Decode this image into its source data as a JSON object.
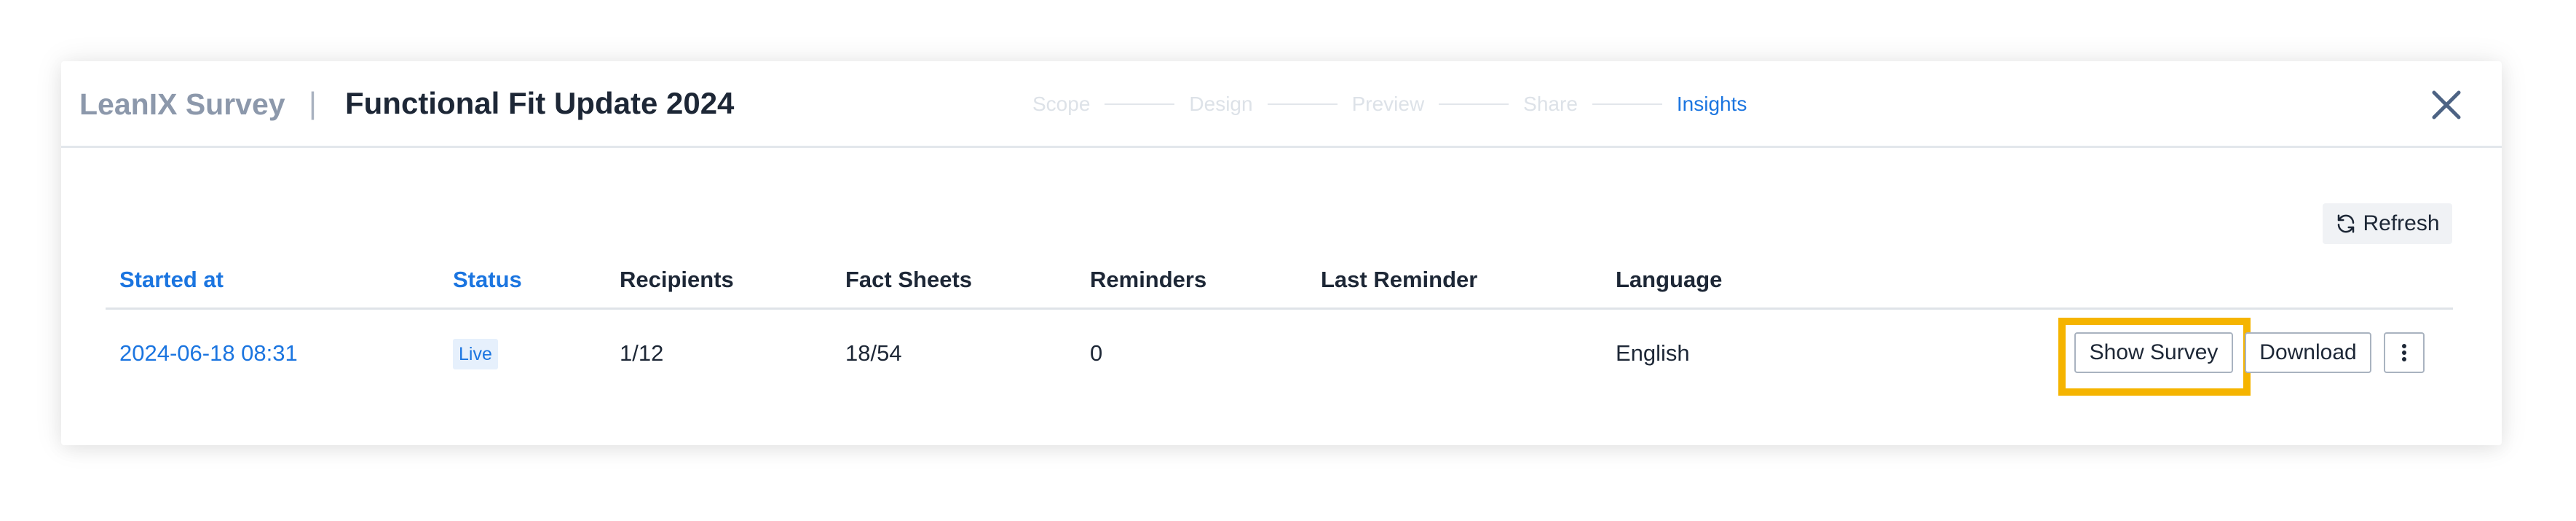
{
  "header": {
    "brand": "LeanIX Survey",
    "divider": "|",
    "title": "Functional Fit Update 2024",
    "steps": [
      {
        "label": "Scope",
        "active": false
      },
      {
        "label": "Design",
        "active": false
      },
      {
        "label": "Preview",
        "active": false
      },
      {
        "label": "Share",
        "active": false
      },
      {
        "label": "Insights",
        "active": true
      }
    ],
    "close_icon": "close-icon"
  },
  "toolbar": {
    "refresh_label": "Refresh",
    "refresh_icon": "refresh-icon"
  },
  "table": {
    "columns": [
      "Started at",
      "Status",
      "Recipients",
      "Fact Sheets",
      "Reminders",
      "Last Reminder",
      "Language"
    ],
    "rows": [
      {
        "started_at": "2024-06-18 08:31",
        "status": "Live",
        "recipients": "1/12",
        "fact_sheets": "18/54",
        "reminders": "0",
        "last_reminder": "",
        "language": "English",
        "actions": {
          "show_survey": "Show Survey",
          "download": "Download",
          "more_icon": "more-vertical-icon"
        }
      }
    ]
  },
  "colors": {
    "accent": "#1b75e0",
    "highlight": "#f5b400",
    "muted": "#8c98ab"
  }
}
